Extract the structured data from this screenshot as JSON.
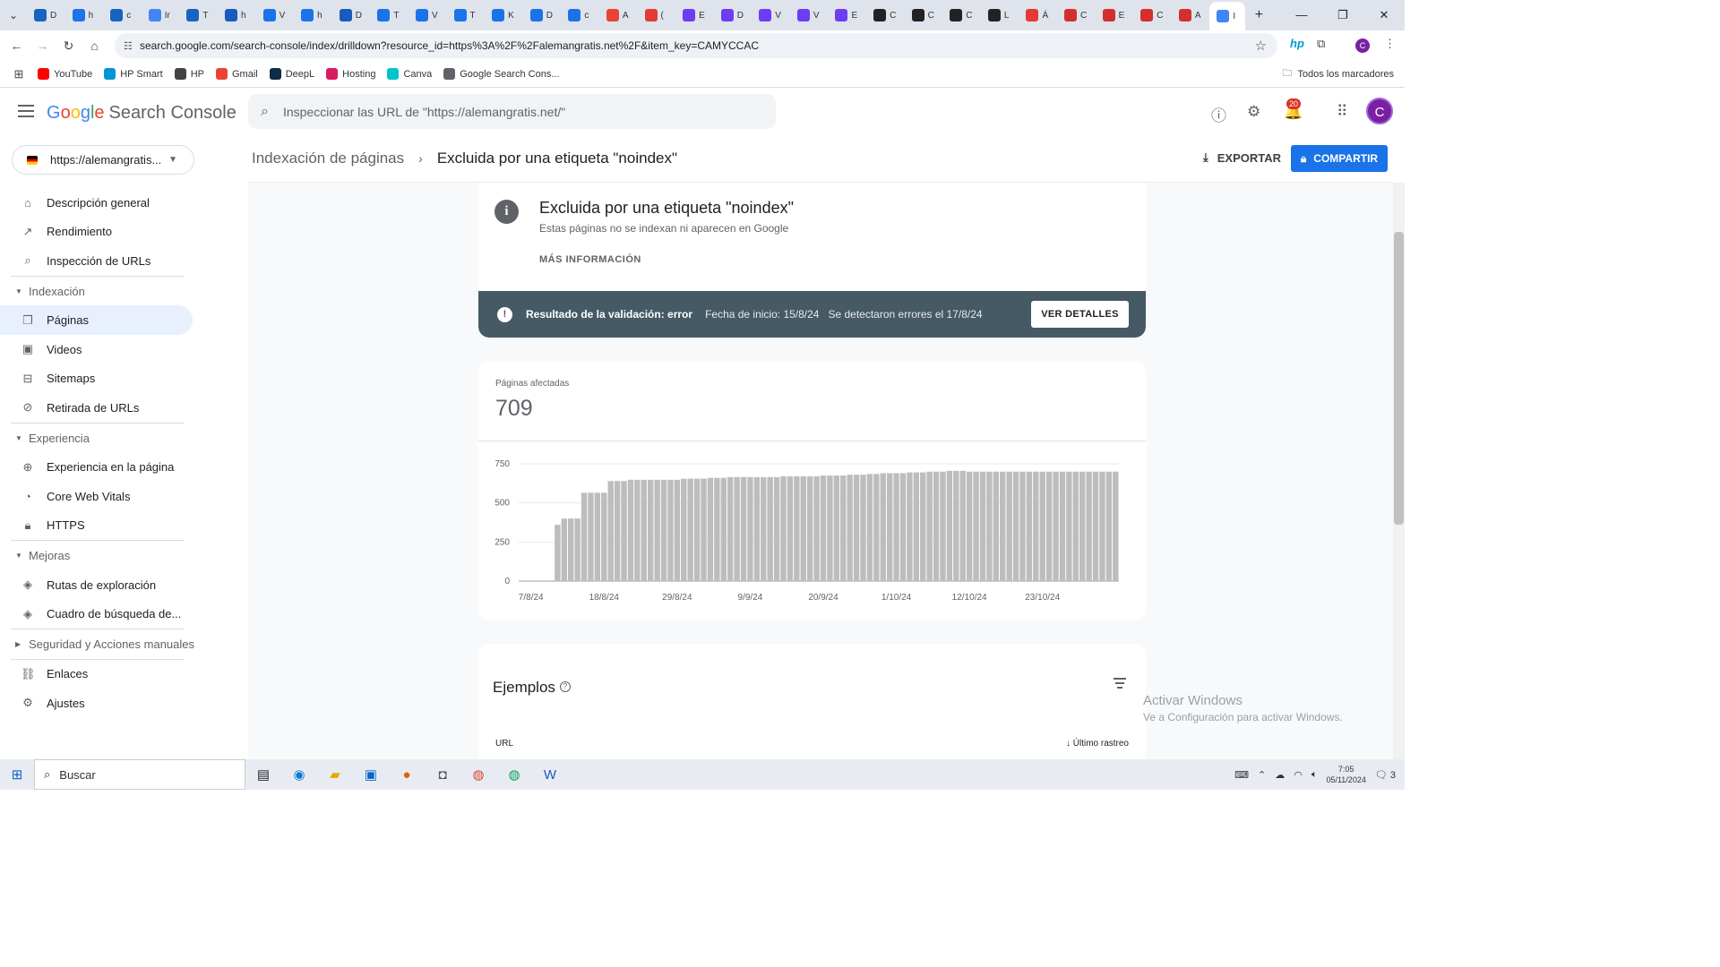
{
  "browser": {
    "tabs": [
      {
        "label": "D",
        "color": "#1565c0"
      },
      {
        "label": "h",
        "color": "#1a73e8"
      },
      {
        "label": "c",
        "color": "#1565c0"
      },
      {
        "label": "Ir",
        "color": "#4285f4"
      },
      {
        "label": "T",
        "color": "#1565c0"
      },
      {
        "label": "h",
        "color": "#185abd"
      },
      {
        "label": "V",
        "color": "#1a73e8"
      },
      {
        "label": "h",
        "color": "#1a73e8"
      },
      {
        "label": "D",
        "color": "#185abd"
      },
      {
        "label": "T",
        "color": "#1a73e8"
      },
      {
        "label": "V",
        "color": "#1a73e8"
      },
      {
        "label": "T",
        "color": "#1a73e8"
      },
      {
        "label": "K",
        "color": "#1a73e8"
      },
      {
        "label": "D",
        "color": "#1a73e8"
      },
      {
        "label": "c",
        "color": "#1a73e8"
      },
      {
        "label": "A",
        "color": "#ea4335"
      },
      {
        "label": "(",
        "color": "#e53935"
      },
      {
        "label": "E",
        "color": "#6c3df3"
      },
      {
        "label": "D",
        "color": "#6c3df3"
      },
      {
        "label": "V",
        "color": "#6c3df3"
      },
      {
        "label": "V",
        "color": "#6c3df3"
      },
      {
        "label": "E",
        "color": "#6c3df3"
      },
      {
        "label": "C",
        "color": "#222222"
      },
      {
        "label": "C",
        "color": "#222222"
      },
      {
        "label": "C",
        "color": "#222222"
      },
      {
        "label": "L",
        "color": "#222222"
      },
      {
        "label": "Á",
        "color": "#e53935"
      },
      {
        "label": "C",
        "color": "#d32f2f"
      },
      {
        "label": "E",
        "color": "#d32f2f"
      },
      {
        "label": "C",
        "color": "#d32f2f"
      },
      {
        "label": "A",
        "color": "#d32f2f"
      },
      {
        "label": "I",
        "color": "#4285f4"
      }
    ],
    "url": "search.google.com/search-console/index/drilldown?resource_id=https%3A%2F%2Falemangratis.net%2F&item_key=CAMYCCAC",
    "bookmarks": [
      {
        "label": "YouTube",
        "color": "#ff0000"
      },
      {
        "label": "HP Smart",
        "color": "#0096d6"
      },
      {
        "label": "HP",
        "color": "#444444"
      },
      {
        "label": "Gmail",
        "color": "#ea4335"
      },
      {
        "label": "DeepL",
        "color": "#0f2b46"
      },
      {
        "label": "Hosting",
        "color": "#d81b60"
      },
      {
        "label": "Canva",
        "color": "#00c4cc"
      },
      {
        "label": "Google Search Cons...",
        "color": "#5f6368"
      }
    ],
    "all_bookmarks": "Todos los marcadores"
  },
  "app": {
    "logo_google": [
      "G",
      "o",
      "o",
      "g",
      "l",
      "e"
    ],
    "logo_product": "Search Console",
    "search_placeholder": "Inspeccionar las URL de \"https://alemangratis.net/\"",
    "notification_count": "20",
    "avatar_letter": "C",
    "property": "https://alemangratis..."
  },
  "sidebar": {
    "top": [
      {
        "label": "Descripción general",
        "icon": "home-icon"
      },
      {
        "label": "Rendimiento",
        "icon": "trending-up-icon"
      },
      {
        "label": "Inspección de URLs",
        "icon": "search-icon"
      }
    ],
    "indexacion": {
      "title": "Indexación",
      "items": [
        {
          "label": "Páginas",
          "icon": "pages-icon",
          "active": true
        },
        {
          "label": "Videos",
          "icon": "video-icon"
        },
        {
          "label": "Sitemaps",
          "icon": "sitemap-icon"
        },
        {
          "label": "Retirada de URLs",
          "icon": "eye-off-icon"
        }
      ]
    },
    "experiencia": {
      "title": "Experiencia",
      "items": [
        {
          "label": "Experiencia en la página",
          "icon": "plus-circle-icon"
        },
        {
          "label": "Core Web Vitals",
          "icon": "speedometer-icon"
        },
        {
          "label": "HTTPS",
          "icon": "lock-icon"
        }
      ]
    },
    "mejoras": {
      "title": "Mejoras",
      "items": [
        {
          "label": "Rutas de exploración",
          "icon": "layers-icon"
        },
        {
          "label": "Cuadro de búsqueda de...",
          "icon": "layers-icon"
        }
      ]
    },
    "seguridad": {
      "title": "Seguridad y Acciones manuales"
    },
    "bottom": [
      {
        "label": "Enlaces",
        "icon": "link-icon"
      },
      {
        "label": "Ajustes",
        "icon": "gear-icon"
      }
    ]
  },
  "header": {
    "breadcrumb_parent": "Indexación de páginas",
    "breadcrumb_current": "Excluida por una etiqueta \"noindex\"",
    "export_label": "EXPORTAR",
    "share_label": "COMPARTIR"
  },
  "issue_card": {
    "title": "Excluida por una etiqueta \"noindex\"",
    "subtitle": "Estas páginas no se indexan ni aparecen en Google",
    "more_info": "MÁS INFORMACIÓN",
    "validation_result": "Resultado de la validación: error",
    "start_date": "Fecha de inicio: 15/8/24",
    "errors_detected": "Se detectaron errores el 17/8/24",
    "details_button": "VER DETALLES"
  },
  "affected": {
    "label": "Páginas afectadas",
    "value": "709"
  },
  "chart_data": {
    "type": "bar",
    "ylim": [
      0,
      750
    ],
    "yticks": [
      "0",
      "250",
      "500",
      "750"
    ],
    "xticks": [
      "7/8/24",
      "18/8/24",
      "29/8/24",
      "9/9/24",
      "20/9/24",
      "1/10/24",
      "12/10/24",
      "23/10/24"
    ],
    "start_date": "2024-08-07",
    "values": [
      0,
      0,
      0,
      0,
      360,
      400,
      400,
      400,
      565,
      565,
      565,
      565,
      640,
      640,
      640,
      648,
      648,
      648,
      648,
      648,
      648,
      648,
      648,
      655,
      655,
      655,
      655,
      660,
      660,
      660,
      665,
      665,
      665,
      665,
      665,
      665,
      665,
      665,
      670,
      670,
      670,
      670,
      670,
      670,
      675,
      675,
      675,
      675,
      680,
      680,
      680,
      685,
      685,
      690,
      690,
      690,
      690,
      695,
      695,
      695,
      700,
      700,
      700,
      705,
      705,
      705,
      700,
      700,
      700,
      700,
      700,
      700,
      700,
      700,
      700,
      700,
      700,
      700,
      700,
      700,
      700,
      700,
      700,
      700,
      700,
      700,
      700,
      700,
      700
    ]
  },
  "examples": {
    "title": "Ejemplos",
    "url_header": "URL",
    "last_crawl_header": "Último rastreo"
  },
  "watermark": {
    "line1": "Activar Windows",
    "line2": "Ve a Configuración para activar Windows."
  },
  "taskbar": {
    "search_label": "Buscar",
    "time": "7:05",
    "date": "05/11/2024",
    "notifications": "3"
  }
}
